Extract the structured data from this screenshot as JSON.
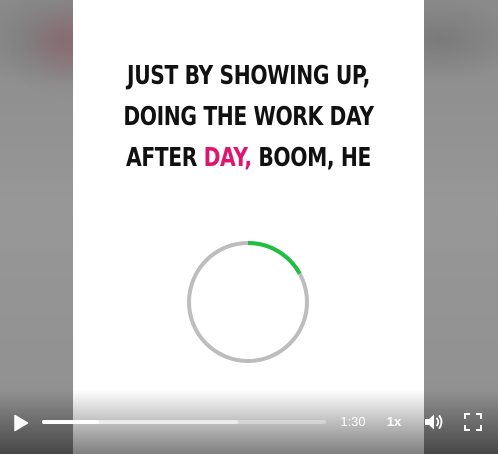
{
  "video": {
    "caption_lines": [
      {
        "text": "JUST BY SHOWING UP,"
      },
      {
        "text": "DOING THE WORK DAY"
      },
      {
        "before": "AFTER ",
        "accent": "DAY,",
        "after": " BOOM, HE"
      }
    ],
    "accent_color": "#e0156d",
    "loading_progress": 0.17,
    "spinner_track_color": "#bdbdbd",
    "spinner_progress_color": "#1fbf3f"
  },
  "controls": {
    "play_icon": "play-icon",
    "played_fraction": 0.2,
    "buffered_fraction": 0.69,
    "time": "1:30",
    "speed": "1x",
    "volume_icon": "volume-icon",
    "fullscreen_icon": "fullscreen-icon"
  }
}
